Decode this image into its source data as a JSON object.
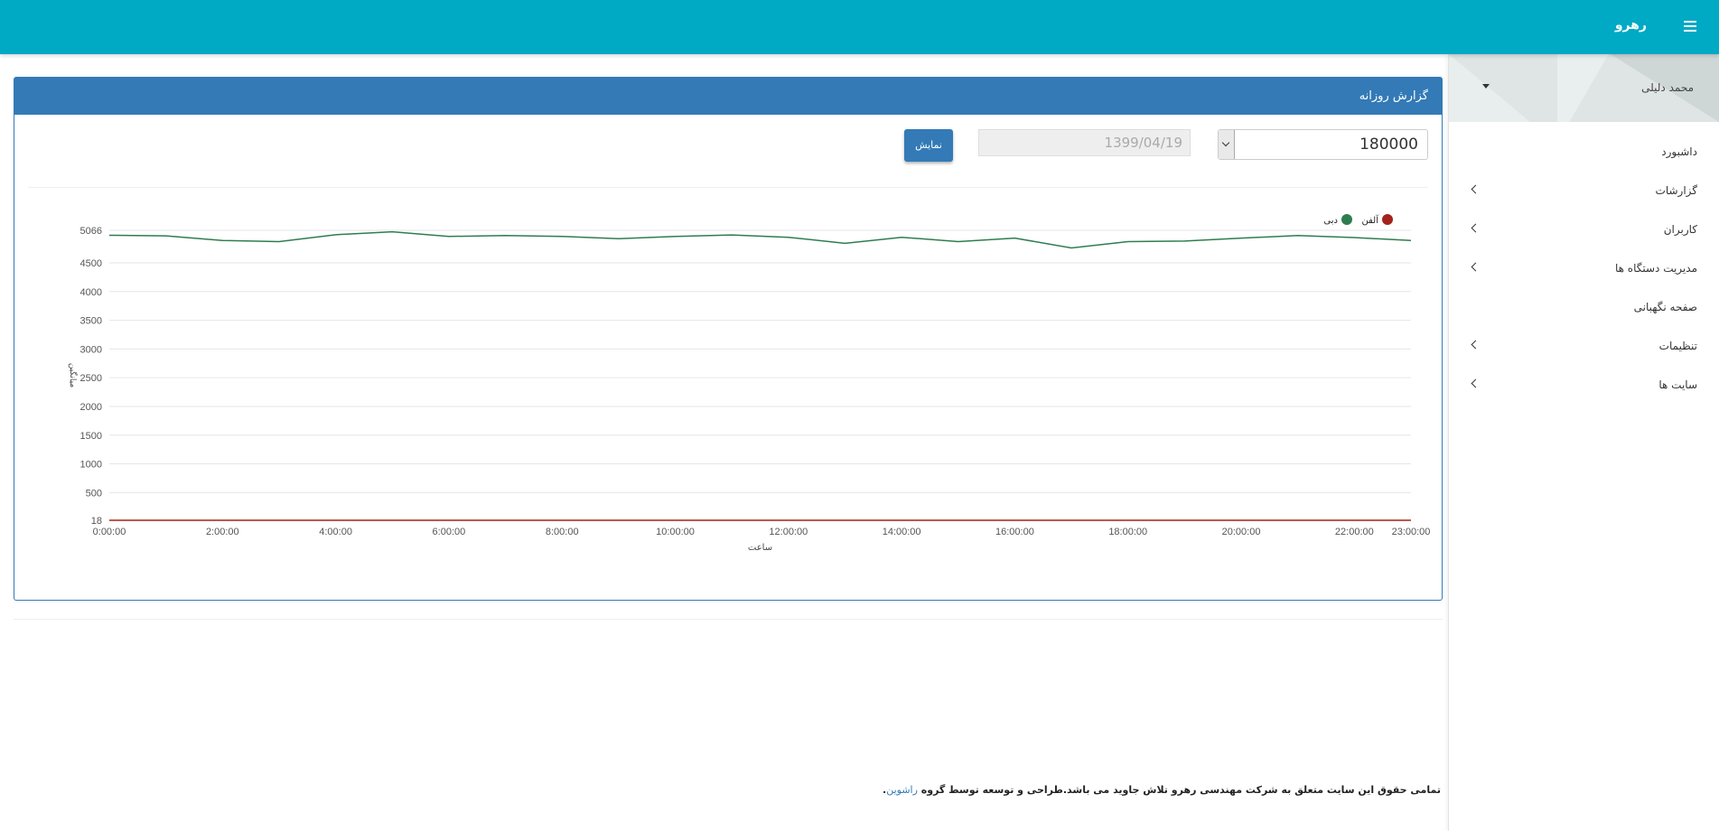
{
  "app": {
    "brand": "رهرو"
  },
  "sidebar": {
    "user_name": "محمد دلیلی",
    "items": [
      {
        "label": "داشبورد",
        "has_submenu": false
      },
      {
        "label": "گزارشات",
        "has_submenu": true
      },
      {
        "label": "کاربران",
        "has_submenu": true
      },
      {
        "label": "مدیریت دستگاه ها",
        "has_submenu": true
      },
      {
        "label": "صفحه نگهبانی",
        "has_submenu": false
      },
      {
        "label": "تنظیمات",
        "has_submenu": true
      },
      {
        "label": "سایت ها",
        "has_submenu": true
      }
    ]
  },
  "panel": {
    "title": "گزارش روزانه",
    "select_value": "180000",
    "date_value": "1399/04/19",
    "show_button": "نمایش"
  },
  "chart_data": {
    "type": "line",
    "xlabel": "ساعت",
    "ylabel": "میانگین",
    "x": [
      "0:00:00",
      "1:00:00",
      "2:00:00",
      "3:00:00",
      "4:00:00",
      "5:00:00",
      "6:00:00",
      "7:00:00",
      "8:00:00",
      "9:00:00",
      "10:00:00",
      "11:00:00",
      "12:00:00",
      "13:00:00",
      "14:00:00",
      "15:00:00",
      "16:00:00",
      "17:00:00",
      "18:00:00",
      "19:00:00",
      "20:00:00",
      "21:00:00",
      "22:00:00",
      "23:00:00"
    ],
    "x_tick_labels": [
      "0:00:00",
      "2:00:00",
      "4:00:00",
      "6:00:00",
      "8:00:00",
      "10:00:00",
      "12:00:00",
      "14:00:00",
      "16:00:00",
      "18:00:00",
      "20:00:00",
      "22:00:00",
      "23:00:00"
    ],
    "y_ticks": [
      18,
      500,
      1000,
      1500,
      2000,
      2500,
      3000,
      3500,
      4000,
      4500,
      5066
    ],
    "ylim": [
      18,
      5066
    ],
    "legend": [
      {
        "name": "آلفن",
        "color": "#a3231c"
      },
      {
        "name": "دبی",
        "color": "#2e7d4f"
      }
    ],
    "legend_placement": "top-right",
    "grid": true,
    "series": [
      {
        "name": "دبی",
        "color": "#2e7d4f",
        "values": [
          4980,
          4970,
          4890,
          4870,
          4990,
          5040,
          4960,
          4975,
          4960,
          4920,
          4960,
          4985,
          4945,
          4840,
          4945,
          4870,
          4930,
          4760,
          4870,
          4880,
          4930,
          4975,
          4940,
          4890
        ]
      },
      {
        "name": "آلفن",
        "color": "#a3231c",
        "values": [
          18,
          18,
          18,
          18,
          18,
          18,
          18,
          18,
          18,
          18,
          18,
          18,
          18,
          18,
          18,
          18,
          18,
          18,
          18,
          18,
          18,
          18,
          18,
          18
        ]
      }
    ]
  },
  "footer": {
    "text": "تمامی حقوق این سایت متعلق به شرکت مهندسی رهرو تلاش جاوید می باشد.طراحی و توسعه توسط گروه",
    "link": "راشوین",
    "suffix": "."
  }
}
